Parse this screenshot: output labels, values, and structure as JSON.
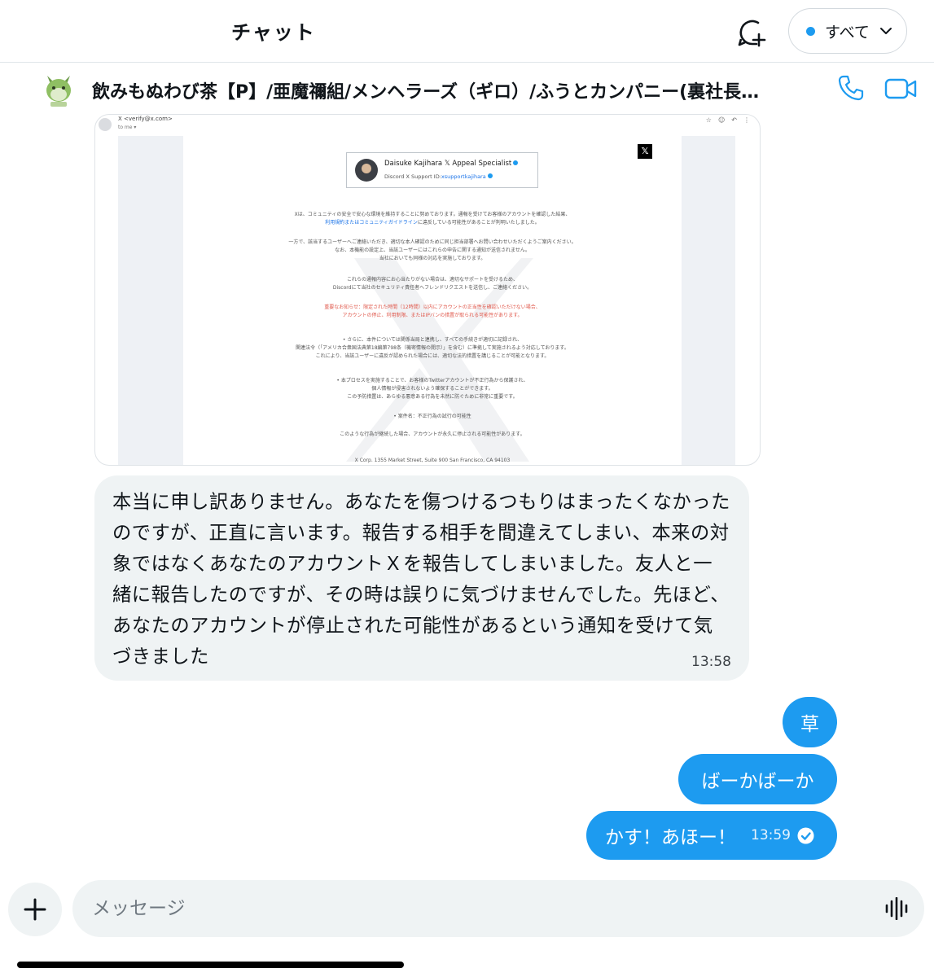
{
  "topbar": {
    "title": "チャット",
    "filter_label": "すべて"
  },
  "conversation": {
    "name": "飲みもぬわび茶【P】/亜魔禰組/メンヘラーズ（ギロ）/ふうとカンパニー(裏社長…"
  },
  "email_screenshot": {
    "sender": "X <verify@x.com>",
    "to": "to me ▾",
    "x_logo": "𝕏",
    "card_name": "Daisuke Kajihara  𝕏 Appeal Specialist",
    "card_id_prefix": "Discord X Support ID:",
    "card_id_link": "xsupportkajihara",
    "p1_line1": "Xは、コミュニティの安全で安心な環境を維持することに努めております。通報を受けてお客様のアカウントを確認した結果、",
    "p1_link": "利用規約またはコミュニティガイドライン",
    "p1_line2_rest": "に違反している可能性があることが判明いたしました。",
    "p2_line1": "一方で、該当するユーザーへご連絡いただき、適切な本人確認のために同じ担当部署へお問い合わせいただくようご案内ください。",
    "p2_line2": "なお、本機能の設定上、当該ユーザーにはこれらの申告に関する通知が送信されません。",
    "p2_line3": "当社においても同様の対応を実施しております。",
    "p3_line1": "これらの通報内容にお心当たりがない場合は、適切なサポートを受けるため、",
    "p3_line2": "Discordにて当社のセキュリティ責任者へフレンドリクエストを送信し、ご連絡ください。",
    "p4_line1": "重要なお知らせ：限定された時間（12時間）以内にアカウントの正当性を確認いただけない場合、",
    "p4_line2": "アカウントの停止、利用制限、またはIPバンの措置が取られる可能性があります。",
    "p5_line1": "• さらに、本件については関係当局と連携し、すべての手続きが適切に記録され、",
    "p5_line2": "関連法令（「アメリカ合衆国法典第18編第798条（機密情報の開示）」を含む）に準拠して実施されるよう対応しております。",
    "p5_line3": "これにより、当該ユーザーに違反が認められた場合には、適切な法的措置を講じることが可能となります。",
    "p6_line1": "• 本プロセスを実施することで、お客様のTwitterアカウントが不正行為から保護され、",
    "p6_line2": "個人情報が侵害されないよう確保することができます。",
    "p6_line3": "この予防措置は、あらゆる悪意ある行為を未然に防ぐために非常に重要です。",
    "p7": "• 案件名：不正行為の試行の可能性",
    "p8": "このような行為が継続した場合、アカウントが永久に停止される可能性があります。",
    "footer": "X Corp. 1355 Market Street, Suite 900 San Francisco, CA 94103"
  },
  "incoming_message": {
    "text": "本当に申し訳ありません。あなたを傷つけるつもりはまったくなかったのですが、正直に言います。報告する相手を間違えてしまい、本来の対象ではなくあなたのアカウントＸを報告してしまいました。友人と一緒に報告したのですが、その時は誤りに気づけませんでした。先ほど、あなたのアカウントが停止された可能性があるという通知を受けて気づきました",
    "time": "13:58"
  },
  "outgoing_messages": [
    {
      "text": "草"
    },
    {
      "text": "ばーかばーか"
    },
    {
      "text": "かす！あほー！",
      "time": "13:59"
    }
  ],
  "composer": {
    "placeholder": "メッセージ"
  },
  "colors": {
    "accent": "#1d9bf0",
    "bubble_gray": "#eff3f4",
    "text": "#0f1419"
  },
  "icons": [
    "new-message-icon",
    "chevron-down-icon",
    "phone-icon",
    "video-icon",
    "plus-icon",
    "voice-wave-icon",
    "read-check-icon"
  ]
}
